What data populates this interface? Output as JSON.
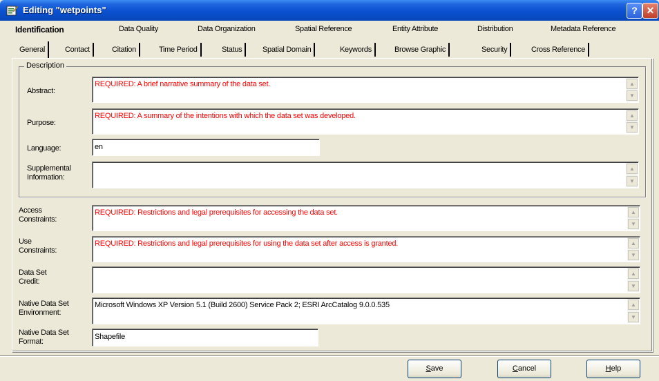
{
  "window": {
    "title": "Editing \"wetpoints\"",
    "help_label": "?",
    "close_label": "✕"
  },
  "main_tabs": [
    {
      "label": "Identification",
      "active": true
    },
    {
      "label": "Data Quality"
    },
    {
      "label": "Data Organization"
    },
    {
      "label": "Spatial Reference"
    },
    {
      "label": "Entity Attribute"
    },
    {
      "label": "Distribution"
    },
    {
      "label": "Metadata Reference"
    }
  ],
  "sub_tabs": [
    {
      "label": "General",
      "active": true
    },
    {
      "label": "Contact"
    },
    {
      "label": "Citation"
    },
    {
      "label": "Time Period"
    },
    {
      "label": "Status"
    },
    {
      "label": "Spatial Domain"
    },
    {
      "label": "Keywords"
    },
    {
      "label": "Browse Graphic"
    },
    {
      "label": "Security"
    },
    {
      "label": "Cross Reference"
    }
  ],
  "description": {
    "legend": "Description",
    "abstract": {
      "label": "Abstract:",
      "value": "REQUIRED: A brief narrative summary of the data set."
    },
    "purpose": {
      "label": "Purpose:",
      "value": "REQUIRED: A summary of the intentions with which the data set was developed."
    },
    "language": {
      "label": "Language:",
      "value": "en"
    },
    "supplemental": {
      "label_line1": "Supplemental",
      "label_line2": "Information:",
      "value": ""
    }
  },
  "access_constraints": {
    "label_line1": "Access",
    "label_line2": "Constraints:",
    "value": "REQUIRED: Restrictions and legal prerequisites for accessing the data set."
  },
  "use_constraints": {
    "label_line1": "Use",
    "label_line2": "Constraints:",
    "value": "REQUIRED: Restrictions and legal prerequisites for using the data set after access is granted."
  },
  "data_set_credit": {
    "label_line1": "Data Set",
    "label_line2": "Credit:",
    "value": ""
  },
  "native_environment": {
    "label_line1": "Native Data Set",
    "label_line2": "Environment:",
    "value": "Microsoft Windows XP Version 5.1 (Build 2600) Service Pack 2; ESRI ArcCatalog 9.0.0.535"
  },
  "native_format": {
    "label_line1": "Native Data Set",
    "label_line2": "Format:",
    "value": "Shapefile"
  },
  "buttons": {
    "save": {
      "mnemonic": "S",
      "rest": "ave"
    },
    "cancel": {
      "mnemonic": "C",
      "rest": "ancel"
    },
    "help": {
      "mnemonic": "H",
      "rest": "elp"
    }
  },
  "colors": {
    "required_text": "#ff0000",
    "titlebar": "#0a50d0",
    "dialog_bg": "#ece9d8"
  },
  "icons": {
    "app": "metadata-editor-icon",
    "help": "question-icon",
    "close": "close-icon",
    "scroll_up": "chevron-up-icon",
    "scroll_down": "chevron-down-icon"
  }
}
